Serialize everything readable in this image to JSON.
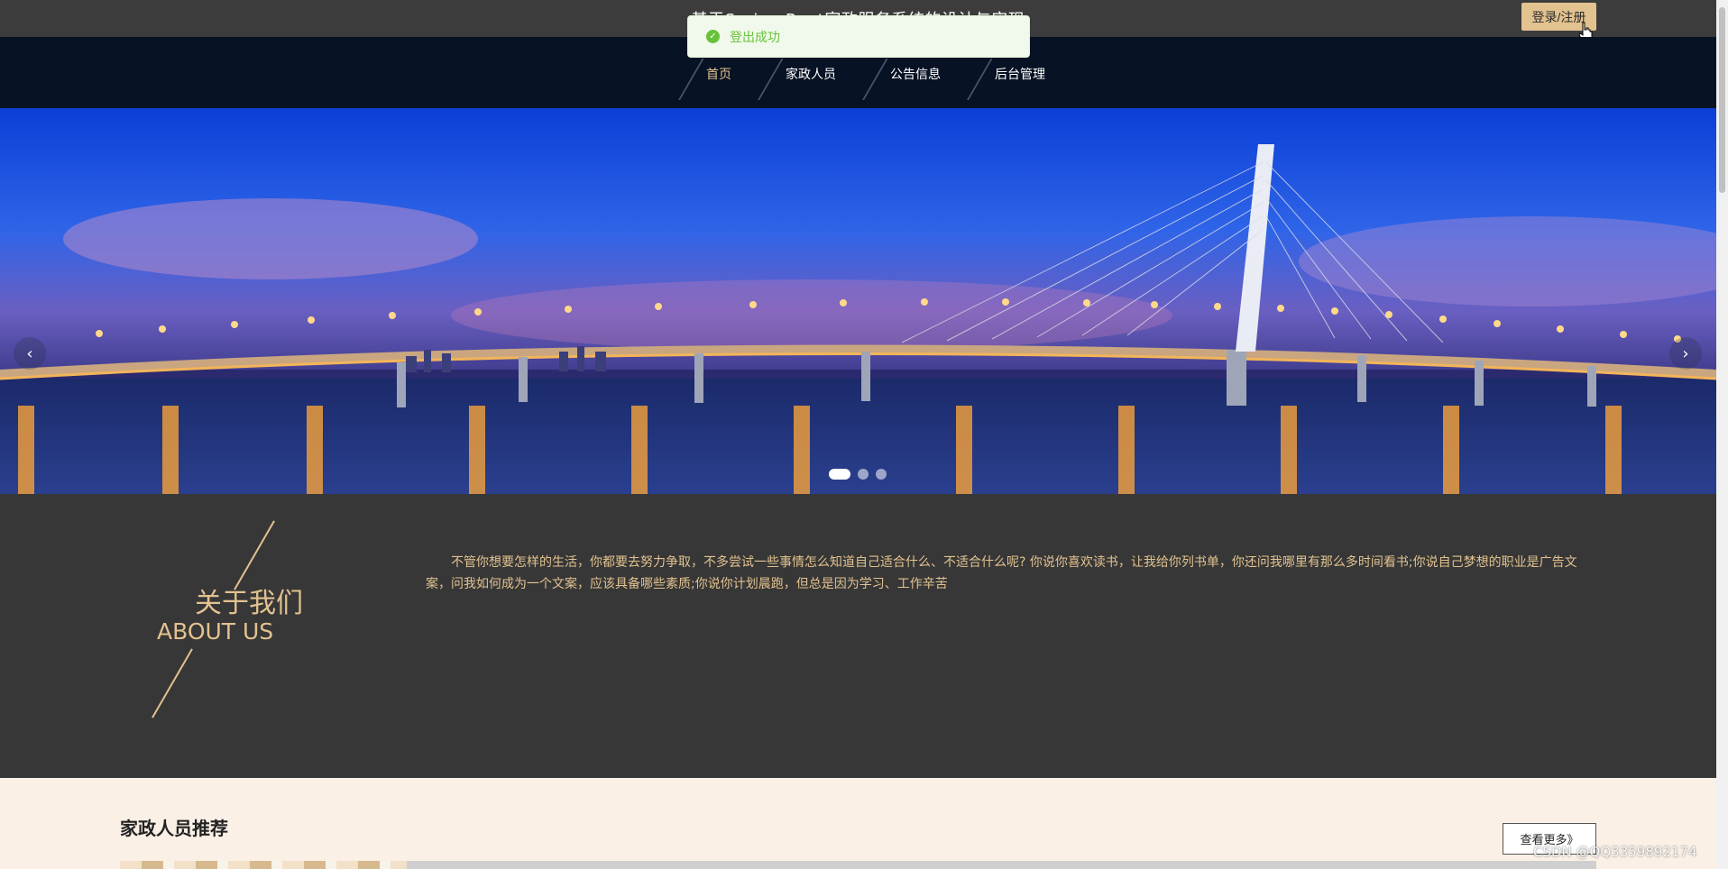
{
  "header": {
    "site_title": "基于Spring Boot家政服务系统的设计与实现",
    "login_label": "登录/注册"
  },
  "toast": {
    "message": "登出成功",
    "icon": "check-circle-icon"
  },
  "nav": {
    "items": [
      {
        "label": "首页",
        "active": true
      },
      {
        "label": "家政人员",
        "active": false
      },
      {
        "label": "公告信息",
        "active": false
      },
      {
        "label": "后台管理",
        "active": false
      }
    ]
  },
  "carousel": {
    "prev_icon": "‹",
    "next_icon": "›",
    "slide_count": 3,
    "active_index": 0
  },
  "about": {
    "title_cn": "关于我们",
    "title_en": "ABOUT US",
    "text": "不管你想要怎样的生活，你都要去努力争取，不多尝试一些事情怎么知道自己适合什么、不适合什么呢? 你说你喜欢读书，让我给你列书单，你还问我哪里有那么多时间看书;你说自己梦想的职业是广告文案，问我如何成为一个文案，应该具备哪些素质;你说你计划晨跑，但总是因为学习、工作辛苦"
  },
  "recommend": {
    "title": "家政人员推荐",
    "more_label": "查看更多》"
  },
  "watermark": "CSDN @QQ3359892174",
  "colors": {
    "accent": "#e2c28f",
    "topbar": "#3c3c3c",
    "nav": "#071224",
    "about_bg": "#373737",
    "toast_green": "#67c23a"
  }
}
